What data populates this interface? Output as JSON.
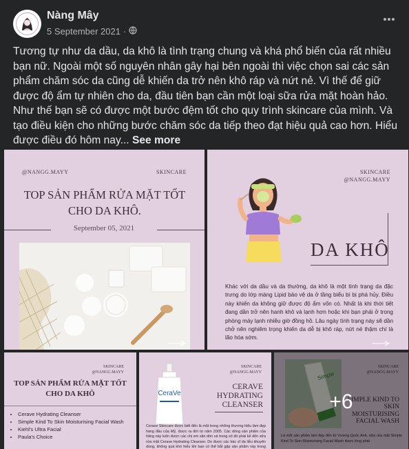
{
  "post": {
    "author": "Nàng Mây",
    "date": "5 September 2021",
    "separator": "·",
    "text": "Tương tự như da dầu, da khô là tình trạng chung và khá phổ biến của rất nhiều bạn nữ. Ngoài một số nguyên nhân gây hại bên ngoài thì việc chọn sai các sản phẩm chăm sóc da cũng dễ khiến da trở nên khô ráp và nứt nẻ. Vì thế để giữ được độ ẩm tự nhiên cho da, đầu tiên bạn cần một loại sữa rửa mặt hoàn hảo. Như thế bạn sẽ có được một bước đệm tốt cho quy trình skincare của mình. Và tạo điều kiện cho những bước chăm sóc da tiếp theo đạt hiệu quả cao hơn. Hiểu được điều đó hôm nay...",
    "see_more": "See more"
  },
  "tile1": {
    "handle": "@NANGG.MAYY",
    "category": "SKINCARE",
    "title": "TOP SẢN PHẨM RỬA MẶT TỐT CHO DA KHÔ.",
    "date": "September 05, 2021"
  },
  "tile2": {
    "category": "SKINCARE",
    "handle": "@NANGG.MAYY",
    "title": "DA KHÔ",
    "body": "Khác với da dầu và da thường, da khô là một tình trạng da đặc trưng do lớp màng Lipid bảo vệ da ở tầng biểu bì bị phá hủy. Điều này khiến da không giữ được độ ẩm vốn có. Nhất là khi thời tiết đang dần trở nên hanh khô và lạnh hơn hoặc khi bạn phải ở trong phòng máy lạnh nhiều giờ đồng hồ. Lâu ngày tình trạng này sẽ dần chở nên nghiêm trọng khiến da dễ bị khô ráp, nứt nẻ thậm chí là lão hóa sớm."
  },
  "tile3": {
    "category": "SKINCARE",
    "handle": "@NANGG.MAYY",
    "title": "TOP SẢN PHẨM RỬA MẶT TỐT CHO DA KHÔ",
    "items": [
      "Cerave Hydrating Cleanser",
      "Simple Kind To Skin Moisturising Facial Wash",
      "Kiehl's Ultra Facial",
      "Paula's Choice"
    ]
  },
  "tile4": {
    "category": "SKINCARE",
    "handle": "@NANGG.MAYY",
    "title": "CERAVE HYDRATING CLEANSER",
    "body": "Cerave Skincare được biết đến là một trong những thương hiệu làm đẹp hàng đầu của Mỹ, được ra đời từ năm 2005. Các dòng sản phẩm của hãng này luôn được các chị em săn đón và trong số đó phải kể đến sữa rửa mặt Cerave Hydrating Cleanser. Do được các bác sĩ da liễu khuyên dùng, không quá khó hiểu khi bạn có thể bắt gặp sản phẩm này trong các nhà thuốc hoặc tóa kê của bác",
    "bottle_label": "CeraVe"
  },
  "tile5": {
    "category": "SKINCARE",
    "handle": "@NANGG.MAYY",
    "title": "SIMPLE KIND TO SKIN MOISTURISING FACIAL WASH",
    "body": "Là một sản phẩm làm đẹp đến từ Vương Quốc Anh, sữa rửa mặt Simple Kind To Skin Moisturising Facial Wash được lòng phái",
    "bottle_label": "Simple",
    "more_count": "+6"
  },
  "colors": {
    "background": "#242526",
    "tile_pink": "#e2cfe0",
    "text_primary": "#e4e6eb",
    "text_secondary": "#b0b3b8"
  }
}
